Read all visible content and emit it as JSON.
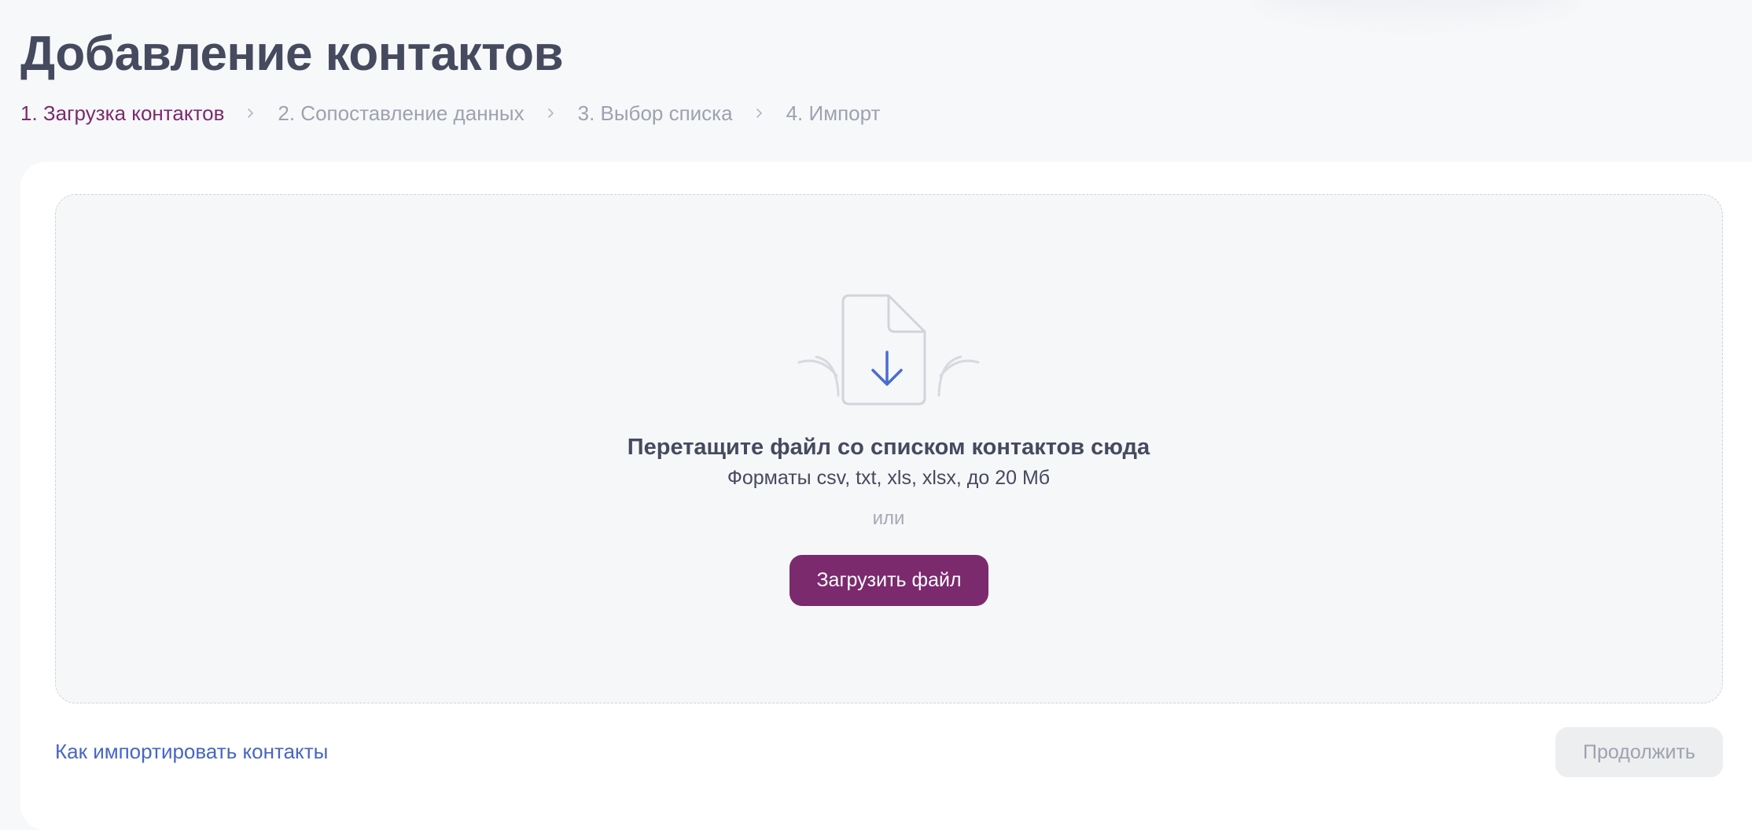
{
  "header": {
    "title": "Добавление контактов"
  },
  "steps": [
    {
      "label": "1. Загрузка контактов",
      "active": true
    },
    {
      "label": "2. Сопоставление данных",
      "active": false
    },
    {
      "label": "3. Выбор списка",
      "active": false
    },
    {
      "label": "4. Импорт",
      "active": false
    }
  ],
  "dropzone": {
    "title": "Перетащите файл со списком контактов сюда",
    "formats": "Форматы csv, txt, xls, xlsx, до 20 Мб",
    "or": "или",
    "upload_label": "Загрузить файл",
    "icon": "file-download-icon"
  },
  "footer": {
    "help_link": "Как импортировать контакты",
    "continue_label": "Продолжить"
  },
  "colors": {
    "accent": "#7b2a6e",
    "link": "#4766c4",
    "text": "#454a5e",
    "muted": "#9ea2af",
    "icon_arrow": "#4a6bd0"
  }
}
